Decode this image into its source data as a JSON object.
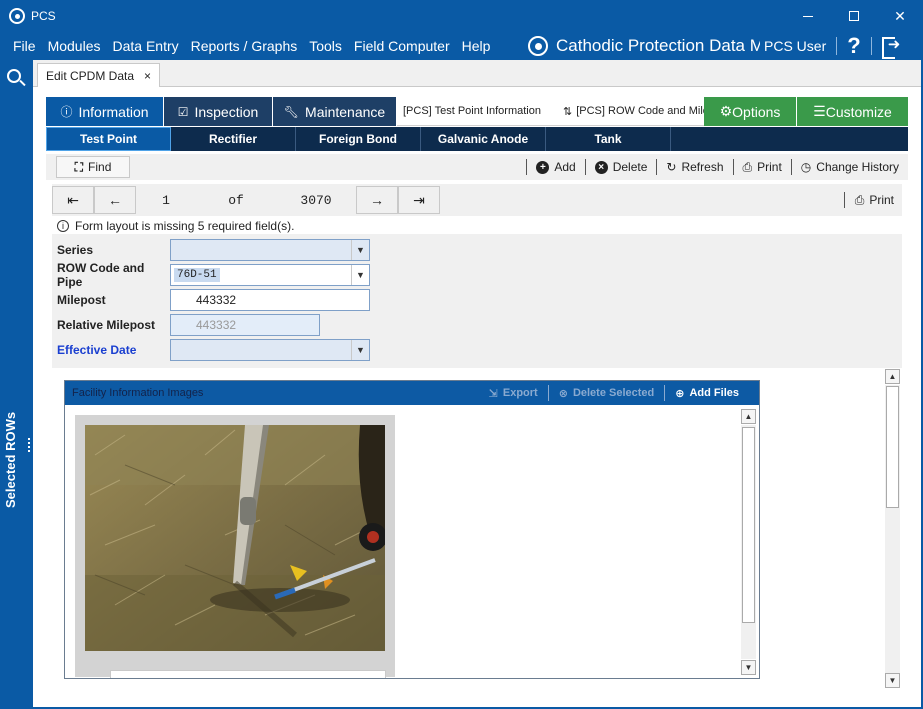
{
  "window": {
    "title": "PCS",
    "minimize": "",
    "maximize": "",
    "close": "✕"
  },
  "menu": {
    "items": [
      "File",
      "Modules",
      "Data Entry",
      "Reports / Graphs",
      "Tools",
      "Field Computer",
      "Help"
    ]
  },
  "header": {
    "app_name": "Cathodic Protection Data Manager",
    "user": "PCS User",
    "help": "?"
  },
  "sidebar": {
    "selected_rows_label": "Selected ROWs"
  },
  "doc_tab": {
    "label": "Edit CPDM Data",
    "close": "×"
  },
  "section_tabs": {
    "information": "Information",
    "inspection": "Inspection",
    "maintenance": "Maintenance",
    "test_point_info": "[PCS] Test Point Information",
    "row_code": "[PCS] ROW Code and Milepost",
    "options": "Options",
    "customize": "Customize"
  },
  "sub_tabs": [
    "Test Point",
    "Rectifier",
    "Foreign Bond",
    "Galvanic Anode",
    "Tank"
  ],
  "toolbar": {
    "find": "Find",
    "add": "Add",
    "delete": "Delete",
    "refresh": "Refresh",
    "print": "Print",
    "change_history": "Change History"
  },
  "navigator": {
    "current": "1",
    "of": "of",
    "total": "3070",
    "print": "Print"
  },
  "warning": "Form layout is missing 5 required field(s).",
  "form": {
    "series_label": "Series",
    "series_value": "",
    "row_label": "ROW Code and Pipe",
    "row_value": "76D-51",
    "milepost_label": "Milepost",
    "milepost_value": "443332",
    "rel_milepost_label": "Relative Milepost",
    "rel_milepost_value": "443332",
    "effective_date_label": "Effective Date",
    "effective_date_value": ""
  },
  "images": {
    "title": "Facility Information Images",
    "export": "Export",
    "delete_selected": "Delete Selected",
    "add_files": "Add Files"
  },
  "colors": {
    "brand_blue": "#0a5aa5",
    "dark_navy": "#1e3f66",
    "green": "#3a9a4a"
  }
}
